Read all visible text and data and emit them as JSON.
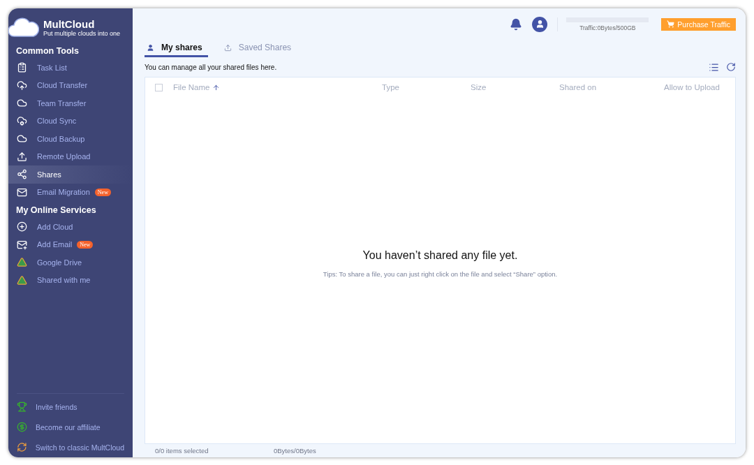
{
  "brand": {
    "name": "MultCloud",
    "tagline": "Put multiple clouds into one"
  },
  "sidebar": {
    "sections": [
      {
        "title": "Common Tools",
        "items": [
          {
            "label": "Task List",
            "selected": false
          },
          {
            "label": "Cloud Transfer",
            "selected": false
          },
          {
            "label": "Team Transfer",
            "selected": false
          },
          {
            "label": "Cloud Sync",
            "selected": false
          },
          {
            "label": "Cloud Backup",
            "selected": false
          },
          {
            "label": "Remote Upload",
            "selected": false
          },
          {
            "label": "Shares",
            "selected": true
          },
          {
            "label": "Email Migration",
            "selected": false,
            "badge": "New"
          }
        ]
      },
      {
        "title": "My Online Services",
        "items": [
          {
            "label": "Add Cloud",
            "selected": false
          },
          {
            "label": "Add Email",
            "selected": false,
            "badge": "New"
          },
          {
            "label": "Google Drive",
            "selected": false
          },
          {
            "label": "Shared with me",
            "selected": false
          }
        ]
      }
    ],
    "footer": [
      {
        "label": "Invite friends"
      },
      {
        "label": "Become our affiliate"
      },
      {
        "label": "Switch to classic MultCloud"
      }
    ]
  },
  "header": {
    "traffic": {
      "label": "Traffic:0Bytes/500GB",
      "level": 0
    },
    "purchase_button": "Purchase Traffic"
  },
  "tabs": [
    {
      "label": "My shares",
      "selected": true
    },
    {
      "label": "Saved Shares",
      "selected": false
    }
  ],
  "description": "You can manage all your shared files here.",
  "table": {
    "select_all_checked": false,
    "columns": [
      "File Name",
      "Type",
      "Size",
      "Shared on",
      "Allow to Upload"
    ]
  },
  "empty_state": {
    "title": "You haven’t shared any file yet.",
    "tip": "Tips: To share a file, you can just right click on the file and select “Share” option."
  },
  "status_bar": {
    "selection": "0/0 items selected",
    "size": "0Bytes/0Bytes"
  }
}
